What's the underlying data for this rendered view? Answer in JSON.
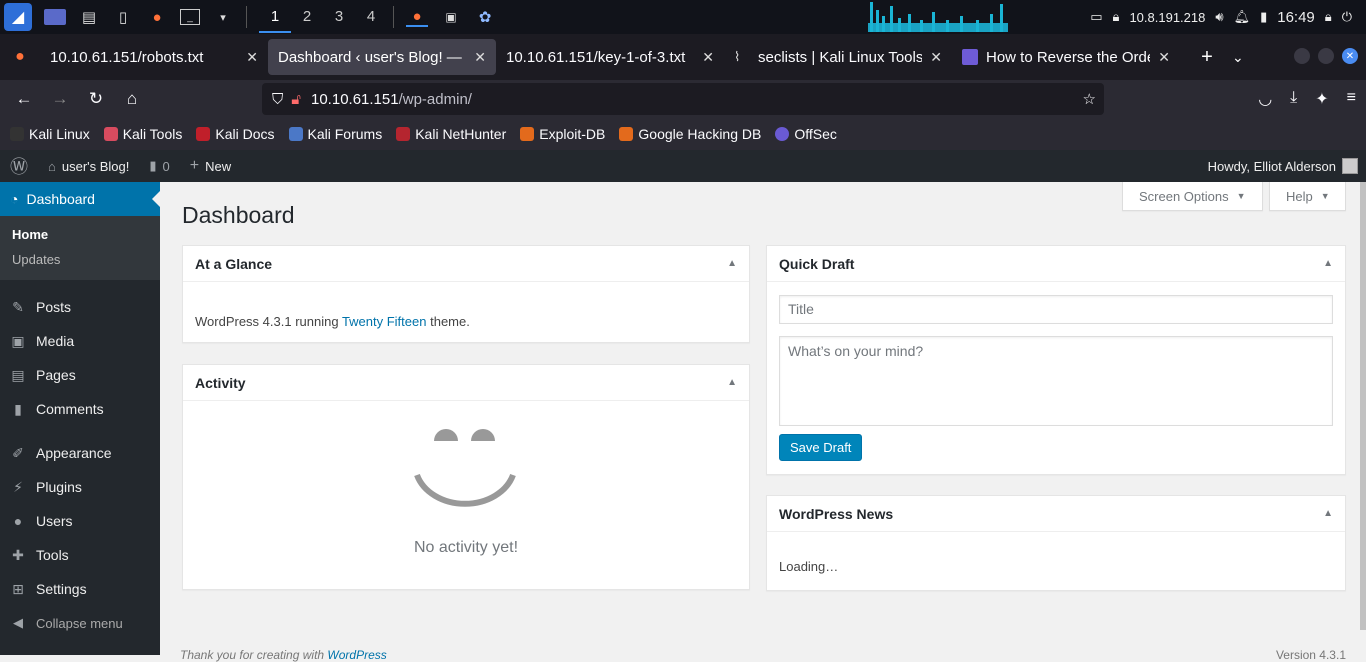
{
  "system": {
    "workspaces": [
      "1",
      "2",
      "3",
      "4"
    ],
    "ip": "10.8.191.218",
    "time": "16:49"
  },
  "tabs": [
    {
      "title": "10.10.61.151/robots.txt",
      "active": false
    },
    {
      "title": "Dashboard ‹ user's Blog! — W",
      "active": true
    },
    {
      "title": "10.10.61.151/key-1-of-3.txt",
      "active": false
    },
    {
      "title": "seclists | Kali Linux Tools",
      "active": false
    },
    {
      "title": "How to Reverse the Order",
      "active": false
    }
  ],
  "address": {
    "host": "10.10.61.151",
    "path": "/wp-admin/"
  },
  "bookmarks": [
    "Kali Linux",
    "Kali Tools",
    "Kali Docs",
    "Kali Forums",
    "Kali NetHunter",
    "Exploit-DB",
    "Google Hacking DB",
    "OffSec"
  ],
  "adminbar": {
    "site": "user's Blog!",
    "comments": "0",
    "new": "New",
    "howdy": "Howdy, Elliot Alderson"
  },
  "menu": {
    "dashboard": "Dashboard",
    "sub": [
      "Home",
      "Updates"
    ],
    "items": [
      "Posts",
      "Media",
      "Pages",
      "Comments",
      "Appearance",
      "Plugins",
      "Users",
      "Tools",
      "Settings"
    ],
    "collapse": "Collapse menu"
  },
  "main": {
    "title": "Dashboard",
    "screen_options": "Screen Options",
    "help": "Help",
    "glance": {
      "title": "At a Glance",
      "text_pre": "WordPress 4.3.1 running ",
      "theme": "Twenty Fifteen",
      "text_post": " theme."
    },
    "activity": {
      "title": "Activity",
      "empty": "No activity yet!"
    },
    "draft": {
      "title": "Quick Draft",
      "title_placeholder": "Title",
      "content_placeholder": "What’s on your mind?",
      "save": "Save Draft"
    },
    "news": {
      "title": "WordPress News",
      "loading": "Loading…"
    },
    "footer_left_pre": "Thank you for creating with ",
    "footer_left_link": "WordPress",
    "footer_right": "Version 4.3.1"
  }
}
